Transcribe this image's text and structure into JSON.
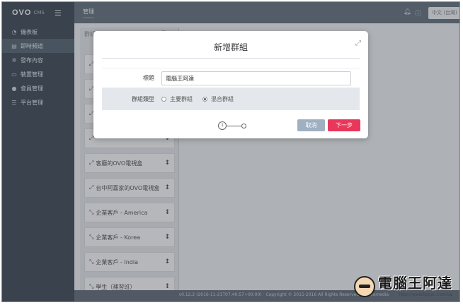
{
  "brand": {
    "logo": "OVO",
    "cms": "CMS",
    "hamburger_icon": "☰"
  },
  "sidebar": {
    "items": [
      {
        "icon": "dashboard-icon",
        "glyph": "◔",
        "label": "儀表板",
        "active": false
      },
      {
        "icon": "channel-icon",
        "glyph": "▤",
        "label": "即時頻道",
        "active": true
      },
      {
        "icon": "publish-icon",
        "glyph": "✲",
        "label": "發布內容",
        "active": false
      },
      {
        "icon": "device-icon",
        "glyph": "▭",
        "label": "裝置管理",
        "active": false
      },
      {
        "icon": "member-icon",
        "glyph": "●",
        "label": "會員管理",
        "active": false
      },
      {
        "icon": "platform-icon",
        "glyph": "☰",
        "label": "平台管理",
        "active": false
      }
    ]
  },
  "topbar": {
    "tab": "管理",
    "lang": "中文 (台灣)"
  },
  "panel": {
    "title": "群組列表",
    "tools": "⎘ +",
    "items": [
      {
        "label": "",
        "icon": "⤢"
      },
      {
        "label": "",
        "icon": "⤢"
      },
      {
        "label": "",
        "icon": "⤢"
      },
      {
        "label": "",
        "icon": "⤢"
      },
      {
        "label": "客廳的OVO電視盒",
        "icon": "⤢"
      },
      {
        "label": "台中阿嘉家的OVO電視盒",
        "icon": "⤢"
      },
      {
        "label": "企業客戶 - America",
        "icon": "⤡"
      },
      {
        "label": "企業客戶 - Korea",
        "icon": "⤡"
      },
      {
        "label": "企業客戶 - India",
        "icon": "⤡"
      },
      {
        "label": "學生（補習班）",
        "icon": "⤡"
      }
    ]
  },
  "footer": {
    "text": "v0.12.2 (2016-11-21T07:40:57+00:00) · Copyright © 2015-2016 All Rights Reserved by Ovomedia"
  },
  "modal": {
    "title": "新增群組",
    "fields": {
      "name_label": "標題",
      "name_value": "電腦王阿達",
      "type_label": "群組類型",
      "type_options": [
        {
          "label": "主要群組",
          "selected": false
        },
        {
          "label": "混合群組",
          "selected": true
        }
      ]
    },
    "step_current": "1",
    "cancel_label": "取消",
    "next_label": "下一步"
  },
  "watermark": {
    "name": "電腦王阿達",
    "url": "http://www.kocpc.com.tw"
  }
}
